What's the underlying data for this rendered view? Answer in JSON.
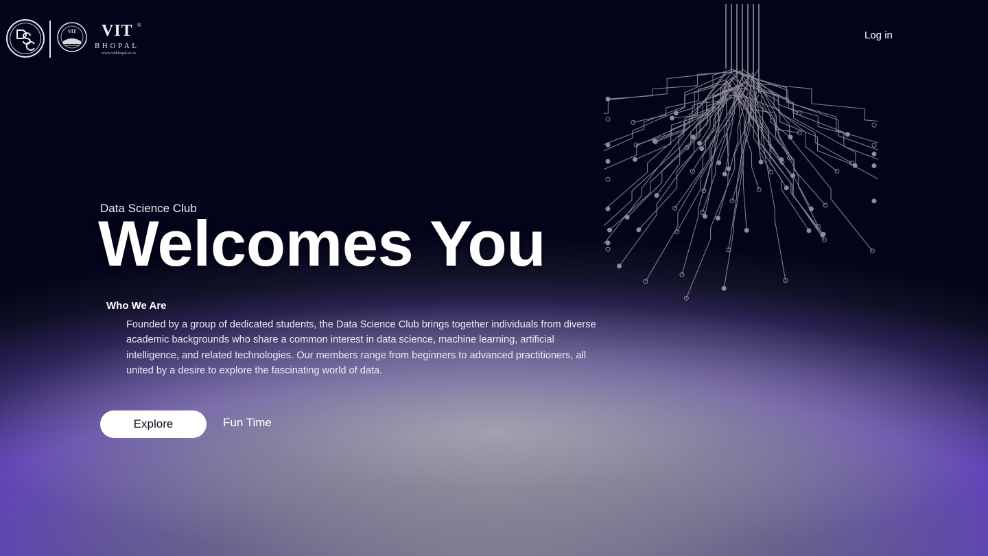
{
  "header": {
    "logo_dsc_letters": "DSC",
    "logo_vit_name": "VIT",
    "logo_vit_reg": "®",
    "logo_vit_city": "BHOPAL",
    "logo_vit_url": "www.vitbhopal.ac.in",
    "login_label": "Log in"
  },
  "hero": {
    "kicker": "Data Science Club",
    "headline": "Welcomes You",
    "section_title": "Who We Are",
    "description": "Founded by a group of dedicated students, the Data Science Club brings together individuals from diverse academic backgrounds who share a common interest in data science, machine learning, artificial intelligence, and related technologies. Our members range from beginners to advanced practitioners, all united by a desire to explore the fascinating world of data.",
    "explore_label": "Explore",
    "fun_label": "Fun Time"
  },
  "colors": {
    "background": "#03031a",
    "accent_purple": "#5a2fd6",
    "circuit_line": "#8e8e96"
  },
  "icons": {
    "circuit_tree": "circuit-tree-illustration"
  }
}
